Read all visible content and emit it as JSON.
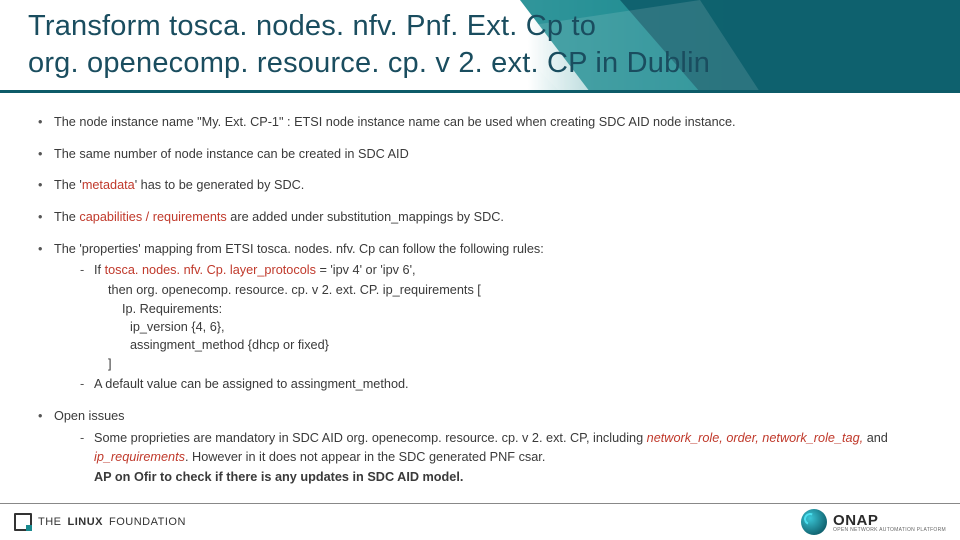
{
  "title_line1": "Transform tosca. nodes. nfv. Pnf. Ext. Cp to",
  "title_line2": "org. openecomp. resource. cp. v 2. ext. CP in Dublin",
  "b1a": "The node instance name \"My. Ext. CP-1\" : ETSI node instance name can be used when creating SDC AID node instance.",
  "b2": "The same number of node instance can be created in SDC AID",
  "b3a": "The '",
  "b3b": "metadata",
  "b3c": "' has to be generated by SDC.",
  "b4a": "The ",
  "b4b": "capabilities / requirements",
  "b4c": " are added under substitution_mappings by SDC.",
  "b5": "The 'properties' mapping from ETSI tosca. nodes. nfv. Cp can follow the following rules:",
  "r1a": "If ",
  "r1b": "tosca. nodes. nfv. Cp. layer_protocols",
  "r1c": " = 'ipv 4' or 'ipv 6',",
  "r2": "then org. openecomp. resource. cp. v 2. ext. CP. ip_requirements [",
  "r3": "Ip. Requirements:",
  "r4": "ip_version {4, 6},",
  "r5": "assingment_method {dhcp or fixed}",
  "r6": "]",
  "d2": "A default value can be assigned to assingment_method.",
  "oi": "Open issues",
  "oi1a": "Some proprieties are mandatory in SDC AID org. openecomp. resource. cp. v 2. ext. CP, including ",
  "oi1b": "network_role, order, network_role_tag,",
  "oi1c": " and ",
  "oi1d": "ip_requirements",
  "oi1e": ". However in it does not appear in the SDC generated PNF csar.",
  "oi2": "AP on Ofir to check if there is any updates in SDC AID model.",
  "lf1": "THE",
  "lf2": "LINUX",
  "lf3": "FOUNDATION",
  "onap": "ONAP",
  "onap_sub": "OPEN NETWORK AUTOMATION PLATFORM"
}
